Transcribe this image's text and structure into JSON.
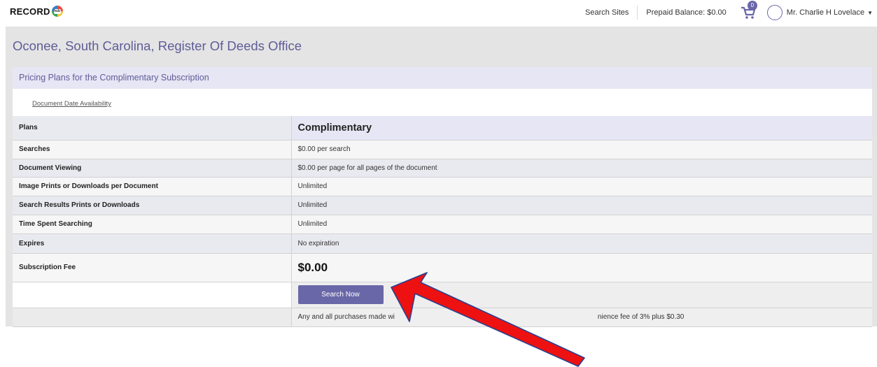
{
  "header": {
    "logo_text": "RECORD",
    "logo_badge_text": "hub",
    "search_sites": "Search Sites",
    "prepaid_balance": "Prepaid Balance: $0.00",
    "cart_count": "0",
    "user_name": "Mr. Charlie H Lovelace"
  },
  "page": {
    "title": "Oconee, South Carolina, Register Of Deeds Office",
    "subheader": "Pricing Plans for the Complimentary Subscription",
    "tab_link": "Document Date Availability"
  },
  "plans": {
    "heading_label": "Plans",
    "plan_name": "Complimentary",
    "rows": [
      {
        "label": "Searches",
        "value": "$0.00 per search"
      },
      {
        "label": "Document Viewing",
        "value": "$0.00 per page for all pages of the document"
      },
      {
        "label": "Image Prints or Downloads per Document",
        "value": "Unlimited"
      },
      {
        "label": "Search Results Prints or Downloads",
        "value": "Unlimited"
      },
      {
        "label": "Time Spent Searching",
        "value": "Unlimited"
      },
      {
        "label": "Expires",
        "value": "No expiration"
      }
    ],
    "fee_label": "Subscription Fee",
    "fee_value": "$0.00",
    "button_label": "Search Now",
    "note_prefix": "Any and all purchases made wi",
    "note_suffix": "nience fee of 3% plus $0.30"
  },
  "colors": {
    "accent": "#6a67a9",
    "title": "#5f5c98",
    "arrow": "#ee1111"
  }
}
